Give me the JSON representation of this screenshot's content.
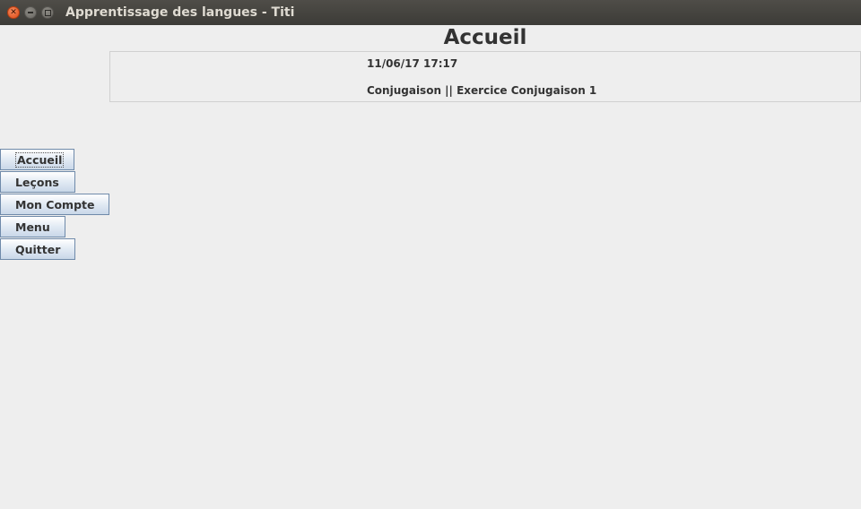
{
  "window": {
    "title": "Apprentissage des langues - Titi"
  },
  "page": {
    "heading": "Accueil"
  },
  "info": {
    "datetime": "11/06/17 17:17",
    "last_activity": "Conjugaison || Exercice Conjugaison 1"
  },
  "nav": {
    "items": [
      {
        "label": "Accueil"
      },
      {
        "label": "Leçons"
      },
      {
        "label": "Mon Compte"
      },
      {
        "label": "Menu"
      },
      {
        "label": "Quitter"
      }
    ]
  }
}
